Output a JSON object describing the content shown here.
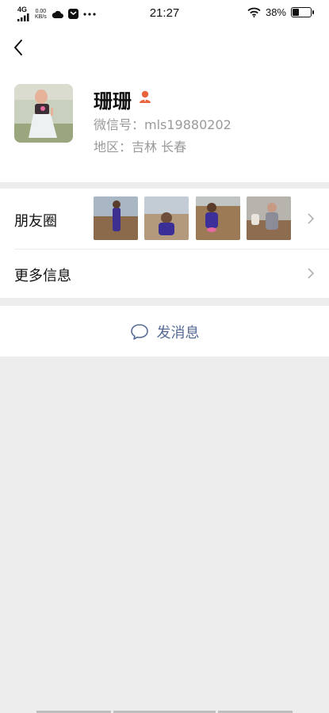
{
  "status_bar": {
    "network": "4G",
    "speed_value": "0.00",
    "speed_unit": "KB/s",
    "time": "21:27",
    "battery_percent": "38%",
    "battery_level": 0.38
  },
  "profile": {
    "name": "珊珊",
    "wechat_id": "微信号：mls19880202",
    "region": "地区：吉林  长春"
  },
  "moments": {
    "label": "朋友圈",
    "thumbnails": [
      "moments-photo-1",
      "moments-photo-2",
      "moments-photo-3",
      "moments-photo-4"
    ]
  },
  "more_info": {
    "label": "更多信息"
  },
  "send_message": {
    "label": "发消息"
  },
  "colors": {
    "link": "#576b95",
    "badge": "#e8643c",
    "background": "#ededed"
  }
}
